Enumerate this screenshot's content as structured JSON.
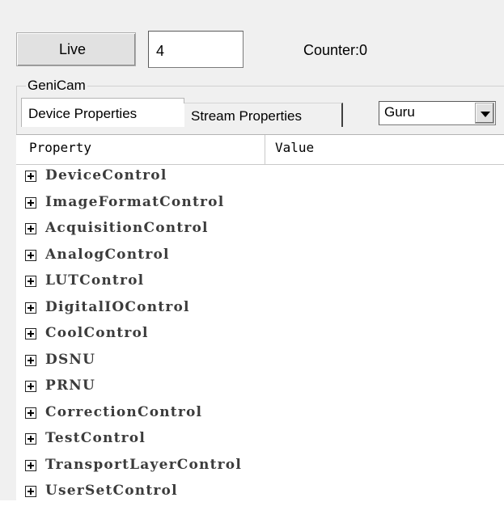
{
  "toolbar": {
    "live_label": "Live",
    "count_value": "4",
    "counter_text": "Counter:0"
  },
  "genicam": {
    "group_title": "GeniCam",
    "tabs": [
      {
        "label": "Device Properties",
        "active": true
      },
      {
        "label": "Stream Properties",
        "active": false
      }
    ],
    "visibility_select": {
      "value": "Guru"
    },
    "grid": {
      "columns": [
        "Property",
        "Value"
      ],
      "rows": [
        {
          "label": "DeviceControl",
          "expander": "plus-box-icon"
        },
        {
          "label": "ImageFormatControl",
          "expander": "plus-box-icon"
        },
        {
          "label": "AcquisitionControl",
          "expander": "plus-box-icon"
        },
        {
          "label": "AnalogControl",
          "expander": "plus-box-icon"
        },
        {
          "label": "LUTControl",
          "expander": "plus-box-icon"
        },
        {
          "label": "DigitalIOControl",
          "expander": "plus-box-icon"
        },
        {
          "label": "CoolControl",
          "expander": "plus-box-icon"
        },
        {
          "label": "DSNU",
          "expander": "plus-box-icon"
        },
        {
          "label": "PRNU",
          "expander": "plus-box-icon"
        },
        {
          "label": "CorrectionControl",
          "expander": "plus-box-icon"
        },
        {
          "label": "TestControl",
          "expander": "plus-box-icon"
        },
        {
          "label": "TransportLayerControl",
          "expander": "plus-box-icon"
        },
        {
          "label": "UserSetControl",
          "expander": "plus-box-icon"
        }
      ]
    }
  }
}
